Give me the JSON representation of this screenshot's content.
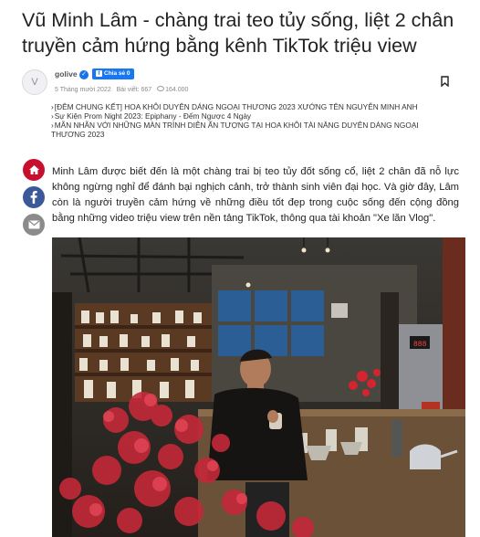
{
  "article": {
    "title": "Vũ Minh Lâm - chàng trai teo tủy sống, liệt 2 chân truyền cảm hứng bằng kênh TikTok triệu view",
    "intro": "Minh Lâm được biết đến là một chàng trai bị teo tủy đốt sống cổ, liệt 2 chân đã nỗ lực không ngừng nghỉ để đánh bại nghịch cảnh, trở thành sinh viên đại học. Và giờ đây, Lâm còn là người truyền cảm hứng về những điều tốt đẹp trong cuộc sống đến cộng đồng bằng những video triệu view trên nền tảng TikTok, thông qua tài khoản \"Xe lăn Vlog\"."
  },
  "meta": {
    "avatar_letter": "V",
    "author": "golive",
    "share_label": "Chia sẻ 0",
    "date": "5 Tháng mười 2022",
    "article_count": "Bài viết: 667",
    "views": "164.000"
  },
  "related": [
    {
      "label": "[ĐÊM CHUNG KẾT] HOA KHÔI DUYÊN DÁNG NGOẠI THƯƠNG 2023 XƯỚNG TÊN NGUYỄN MINH ANH"
    },
    {
      "label": "Sự Kiện Prom Night 2023: Epiphany - Đếm Ngược 4 Ngày"
    },
    {
      "label": "MÃN NHÃN VỚI NHỮNG MÀN TRÌNH DIỄN ẤN TƯỢNG TẠI HOA KHÔI TÀI NĂNG DUYÊN DÁNG NGOẠI THƯƠNG 2023"
    }
  ],
  "icons": {
    "verified": "verified-check-icon",
    "share": "facebook-share-icon",
    "views": "eye-icon",
    "bookmark": "bookmark-icon",
    "home": "home-icon",
    "facebook": "facebook-icon",
    "mail": "mail-icon"
  },
  "colors": {
    "share_button": "#1877f2",
    "home_button": "#c8102e",
    "facebook_button": "#3b5998",
    "mail_button": "#8b8b8b"
  }
}
